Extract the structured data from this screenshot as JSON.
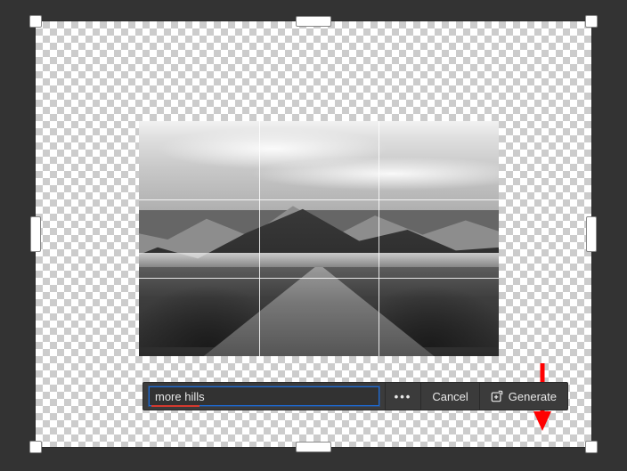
{
  "prompt": {
    "value": "more hills",
    "placeholder": ""
  },
  "buttons": {
    "more_options_aria": "More options",
    "cancel": "Cancel",
    "generate": "Generate"
  },
  "image": {
    "description": "black and white landscape photo of a straight road leading toward mountains under a cloudy sky"
  },
  "annotation": {
    "arrow_target": "Generate button"
  },
  "colors": {
    "focus_ring": "#1d6bd6",
    "spellcheck_underline": "#d63a2f",
    "annotation_arrow": "#ff0000"
  }
}
